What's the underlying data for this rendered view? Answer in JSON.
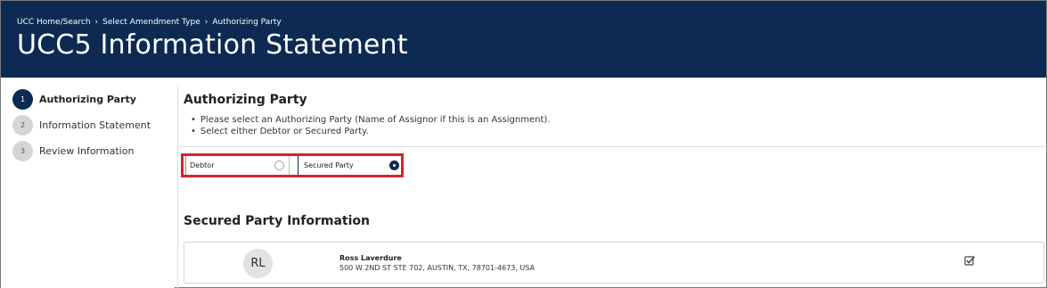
{
  "breadcrumb": {
    "items": [
      "UCC Home/Search",
      "Select Amendment Type",
      "Authorizing Party"
    ],
    "separator": "›"
  },
  "page_title": "UCC5 Information Statement",
  "steps": [
    {
      "number": "1",
      "label": "Authorizing Party",
      "active": true
    },
    {
      "number": "2",
      "label": "Information Statement",
      "active": false
    },
    {
      "number": "3",
      "label": "Review Information",
      "active": false
    }
  ],
  "authorizing_party": {
    "title": "Authorizing Party",
    "instructions": [
      "Please select an Authorizing Party (Name of Assignor if this is an Assignment).",
      "Select either Debtor or Secured Party."
    ],
    "options": [
      {
        "label": "Debtor",
        "selected": false
      },
      {
        "label": "Secured Party",
        "selected": true
      }
    ]
  },
  "secured_party": {
    "title": "Secured Party Information",
    "card": {
      "initials": "RL",
      "name": "Ross Laverdure",
      "address": "500 W 2ND ST STE 702, AUSTIN, TX, 78701-4673, USA"
    }
  },
  "colors": {
    "header_bg": "#0d2a52",
    "highlight_border": "#d8232a",
    "active_step": "#0d2a52"
  }
}
